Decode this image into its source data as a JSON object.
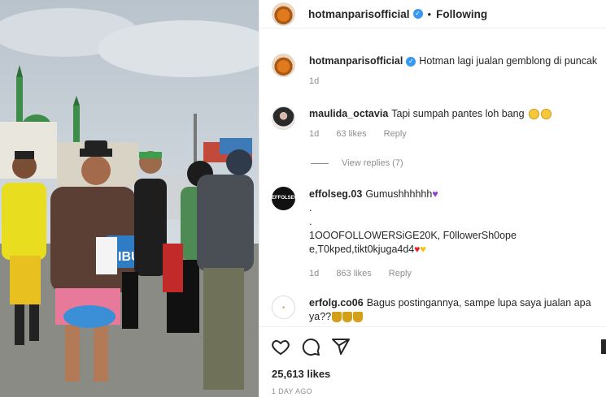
{
  "post": {
    "username": "hotmanparisofficial",
    "follow_status": "Following",
    "caption": "Hotman lagi jualan gemblong di puncak",
    "caption_age": "1d",
    "likes": "25,613 likes",
    "time_ago": "1 DAY AGO"
  },
  "photo": {
    "bucket_label": "IBU"
  },
  "comments": [
    {
      "username": "maulida_octavia",
      "text": "Tapi sumpah pantes loh bang",
      "age": "1d",
      "likes": "63 likes",
      "reply": "Reply",
      "view_replies": "View replies (7)"
    },
    {
      "username": "effolseg.03",
      "avatar_text": "EFFOLSEG",
      "line1": "Gumushhhhhh",
      "line2": ".",
      "line3": ".",
      "line4": "1OOOFOLLOWERSiGE20K, F0llowerSh0ope",
      "line5": "e,T0kped,tikt0kjuga4d4",
      "age": "1d",
      "likes": "863 likes",
      "reply": "Reply"
    },
    {
      "username": "erfolg.co06",
      "text_a": "Bagus postingannya, sampe lupa saya jualan apa",
      "text_b": "ya??"
    }
  ],
  "icons": [
    "verified-badge-icon",
    "heart-icon",
    "comment-icon",
    "share-icon",
    "bookmark-icon"
  ],
  "colors": {
    "verified": "#3897f0",
    "muted": "#8e8e8e",
    "text": "#262626"
  }
}
